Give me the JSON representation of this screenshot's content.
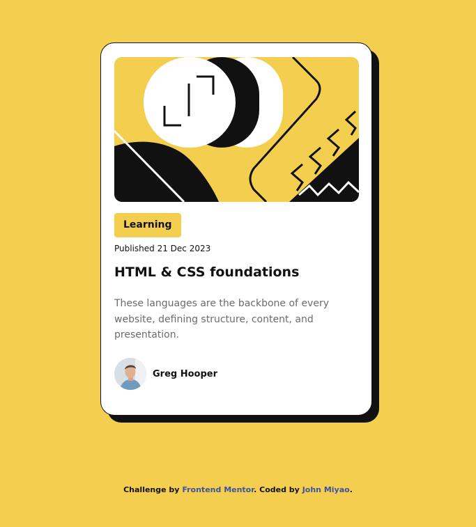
{
  "card": {
    "tag": "Learning",
    "published": "Published 21 Dec 2023",
    "title": "HTML & CSS foundations",
    "description": "These languages are the backbone of every website, defining structure, content, and presentation.",
    "author": {
      "name": "Greg Hooper",
      "avatar_icon": "avatar-photo-icon"
    },
    "hero_icon": "illustration-article-icon"
  },
  "attribution": {
    "prefix": "Challenge by",
    "link1": "Frontend Mentor",
    "middle": ". Coded by",
    "link2": "John Miyao",
    "suffix": "."
  },
  "colors": {
    "background": "#F4CE4E",
    "card": "#FFFFFF",
    "ink": "#111111",
    "muted_text": "#6B6B6B",
    "link": "#3E52A3"
  }
}
